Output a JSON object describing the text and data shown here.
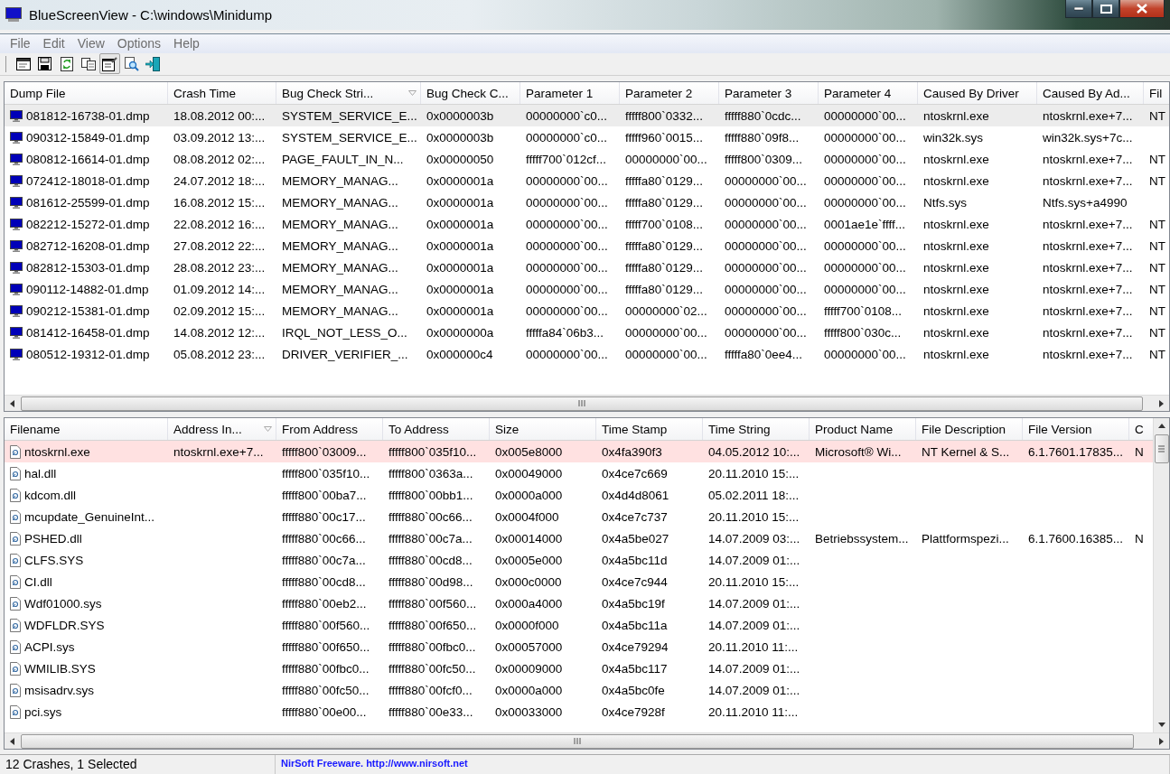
{
  "window": {
    "title": "BlueScreenView  -  C:\\windows\\Minidump"
  },
  "menu": [
    "File",
    "Edit",
    "View",
    "Options",
    "Help"
  ],
  "toolbar": [
    {
      "kind": "window",
      "pressed": false
    },
    {
      "kind": "save",
      "pressed": false
    },
    {
      "kind": "refresh",
      "pressed": false
    },
    {
      "kind": "copy",
      "pressed": false
    },
    {
      "kind": "properties",
      "pressed": true
    },
    {
      "kind": "find",
      "pressed": false
    },
    {
      "kind": "exit",
      "pressed": false
    }
  ],
  "crash_table": {
    "columns": [
      {
        "label": "Dump File",
        "sorted": false
      },
      {
        "label": "Crash Time",
        "sorted": false
      },
      {
        "label": "Bug Check Stri...",
        "sorted": true
      },
      {
        "label": "Bug Check C...",
        "sorted": false
      },
      {
        "label": "Parameter 1",
        "sorted": false
      },
      {
        "label": "Parameter 2",
        "sorted": false
      },
      {
        "label": "Parameter 3",
        "sorted": false
      },
      {
        "label": "Parameter 4",
        "sorted": false
      },
      {
        "label": "Caused By Driver",
        "sorted": false
      },
      {
        "label": "Caused By Ad...",
        "sorted": false
      },
      {
        "label": "Fil",
        "sorted": false
      }
    ],
    "rows": [
      {
        "selected": true,
        "cells": [
          "081812-16738-01.dmp",
          "18.08.2012 00:...",
          "SYSTEM_SERVICE_E...",
          "0x0000003b",
          "00000000`c0...",
          "fffff800`0332...",
          "fffff880`0cdc...",
          "00000000`00...",
          "ntoskrnl.exe",
          "ntoskrnl.exe+7...",
          "NT"
        ]
      },
      {
        "selected": false,
        "cells": [
          "090312-15849-01.dmp",
          "03.09.2012 13:...",
          "SYSTEM_SERVICE_E...",
          "0x0000003b",
          "00000000`c0...",
          "fffff960`0015...",
          "fffff880`09f8...",
          "00000000`00...",
          "win32k.sys",
          "win32k.sys+7c...",
          ""
        ]
      },
      {
        "selected": false,
        "cells": [
          "080812-16614-01.dmp",
          "08.08.2012 02:...",
          "PAGE_FAULT_IN_N...",
          "0x00000050",
          "fffff700`012cf...",
          "00000000`00...",
          "fffff800`0309...",
          "00000000`00...",
          "ntoskrnl.exe",
          "ntoskrnl.exe+7...",
          "NT"
        ]
      },
      {
        "selected": false,
        "cells": [
          "072412-18018-01.dmp",
          "24.07.2012 18:...",
          "MEMORY_MANAG...",
          "0x0000001a",
          "00000000`00...",
          "fffffa80`0129...",
          "00000000`00...",
          "00000000`00...",
          "ntoskrnl.exe",
          "ntoskrnl.exe+7...",
          "NT"
        ]
      },
      {
        "selected": false,
        "cells": [
          "081612-25599-01.dmp",
          "16.08.2012 15:...",
          "MEMORY_MANAG...",
          "0x0000001a",
          "00000000`00...",
          "fffffa80`0129...",
          "00000000`00...",
          "00000000`00...",
          "Ntfs.sys",
          "Ntfs.sys+a4990",
          ""
        ]
      },
      {
        "selected": false,
        "cells": [
          "082212-15272-01.dmp",
          "22.08.2012 16:...",
          "MEMORY_MANAG...",
          "0x0000001a",
          "00000000`00...",
          "fffff700`0108...",
          "00000000`00...",
          "0001ae1e`ffff...",
          "ntoskrnl.exe",
          "ntoskrnl.exe+7...",
          "NT"
        ]
      },
      {
        "selected": false,
        "cells": [
          "082712-16208-01.dmp",
          "27.08.2012 22:...",
          "MEMORY_MANAG...",
          "0x0000001a",
          "00000000`00...",
          "fffffa80`0129...",
          "00000000`00...",
          "00000000`00...",
          "ntoskrnl.exe",
          "ntoskrnl.exe+7...",
          "NT"
        ]
      },
      {
        "selected": false,
        "cells": [
          "082812-15303-01.dmp",
          "28.08.2012 23:...",
          "MEMORY_MANAG...",
          "0x0000001a",
          "00000000`00...",
          "fffffa80`0129...",
          "00000000`00...",
          "00000000`00...",
          "ntoskrnl.exe",
          "ntoskrnl.exe+7...",
          "NT"
        ]
      },
      {
        "selected": false,
        "cells": [
          "090112-14882-01.dmp",
          "01.09.2012 14:...",
          "MEMORY_MANAG...",
          "0x0000001a",
          "00000000`00...",
          "fffffa80`0129...",
          "00000000`00...",
          "00000000`00...",
          "ntoskrnl.exe",
          "ntoskrnl.exe+7...",
          "NT"
        ]
      },
      {
        "selected": false,
        "cells": [
          "090212-15381-01.dmp",
          "02.09.2012 15:...",
          "MEMORY_MANAG...",
          "0x0000001a",
          "00000000`00...",
          "00000000`02...",
          "00000000`00...",
          "fffff700`0108...",
          "ntoskrnl.exe",
          "ntoskrnl.exe+7...",
          "NT"
        ]
      },
      {
        "selected": false,
        "cells": [
          "081412-16458-01.dmp",
          "14.08.2012 12:...",
          "IRQL_NOT_LESS_O...",
          "0x0000000a",
          "fffffa84`06b3...",
          "00000000`00...",
          "00000000`00...",
          "fffff800`030c...",
          "ntoskrnl.exe",
          "ntoskrnl.exe+7...",
          "NT"
        ]
      },
      {
        "selected": false,
        "cells": [
          "080512-19312-01.dmp",
          "05.08.2012 23:...",
          "DRIVER_VERIFIER_...",
          "0x000000c4",
          "00000000`00...",
          "00000000`00...",
          "fffffa80`0ee4...",
          "00000000`00...",
          "ntoskrnl.exe",
          "ntoskrnl.exe+7...",
          "NT"
        ]
      }
    ]
  },
  "driver_table": {
    "columns": [
      {
        "label": "Filename",
        "sorted": false
      },
      {
        "label": "Address In...",
        "sorted": true
      },
      {
        "label": "From Address",
        "sorted": false
      },
      {
        "label": "To Address",
        "sorted": false
      },
      {
        "label": "Size",
        "sorted": false
      },
      {
        "label": "Time Stamp",
        "sorted": false
      },
      {
        "label": "Time String",
        "sorted": false
      },
      {
        "label": "Product Name",
        "sorted": false
      },
      {
        "label": "File Description",
        "sorted": false
      },
      {
        "label": "File Version",
        "sorted": false
      },
      {
        "label": "C",
        "sorted": false
      }
    ],
    "rows": [
      {
        "highlighted": true,
        "cells": [
          "ntoskrnl.exe",
          "ntoskrnl.exe+7...",
          "fffff800`03009...",
          "fffff800`035f10...",
          "0x005e8000",
          "0x4fa390f3",
          "04.05.2012 10:...",
          "Microsoft® Wi...",
          "NT Kernel & S...",
          "6.1.7601.17835...",
          "N"
        ]
      },
      {
        "highlighted": false,
        "cells": [
          "hal.dll",
          "",
          "fffff800`035f10...",
          "fffff800`0363a...",
          "0x00049000",
          "0x4ce7c669",
          "20.11.2010 15:...",
          "",
          "",
          "",
          ""
        ]
      },
      {
        "highlighted": false,
        "cells": [
          "kdcom.dll",
          "",
          "fffff800`00ba7...",
          "fffff800`00bb1...",
          "0x0000a000",
          "0x4d4d8061",
          "05.02.2011 18:...",
          "",
          "",
          "",
          ""
        ]
      },
      {
        "highlighted": false,
        "cells": [
          "mcupdate_GenuineInt...",
          "",
          "fffff880`00c17...",
          "fffff880`00c66...",
          "0x0004f000",
          "0x4ce7c737",
          "20.11.2010 15:...",
          "",
          "",
          "",
          ""
        ]
      },
      {
        "highlighted": false,
        "cells": [
          "PSHED.dll",
          "",
          "fffff880`00c66...",
          "fffff880`00c7a...",
          "0x00014000",
          "0x4a5be027",
          "14.07.2009 03:...",
          "Betriebssystem...",
          "Plattformspezi...",
          "6.1.7600.16385...",
          "N"
        ]
      },
      {
        "highlighted": false,
        "cells": [
          "CLFS.SYS",
          "",
          "fffff880`00c7a...",
          "fffff880`00cd8...",
          "0x0005e000",
          "0x4a5bc11d",
          "14.07.2009 01:...",
          "",
          "",
          "",
          ""
        ]
      },
      {
        "highlighted": false,
        "cells": [
          "CI.dll",
          "",
          "fffff880`00cd8...",
          "fffff880`00d98...",
          "0x000c0000",
          "0x4ce7c944",
          "20.11.2010 15:...",
          "",
          "",
          "",
          ""
        ]
      },
      {
        "highlighted": false,
        "cells": [
          "Wdf01000.sys",
          "",
          "fffff880`00eb2...",
          "fffff880`00f560...",
          "0x000a4000",
          "0x4a5bc19f",
          "14.07.2009 01:...",
          "",
          "",
          "",
          ""
        ]
      },
      {
        "highlighted": false,
        "cells": [
          "WDFLDR.SYS",
          "",
          "fffff880`00f560...",
          "fffff880`00f650...",
          "0x0000f000",
          "0x4a5bc11a",
          "14.07.2009 01:...",
          "",
          "",
          "",
          ""
        ]
      },
      {
        "highlighted": false,
        "cells": [
          "ACPI.sys",
          "",
          "fffff880`00f650...",
          "fffff880`00fbc0...",
          "0x00057000",
          "0x4ce79294",
          "20.11.2010 11:...",
          "",
          "",
          "",
          ""
        ]
      },
      {
        "highlighted": false,
        "cells": [
          "WMILIB.SYS",
          "",
          "fffff880`00fbc0...",
          "fffff880`00fc50...",
          "0x00009000",
          "0x4a5bc117",
          "14.07.2009 01:...",
          "",
          "",
          "",
          ""
        ]
      },
      {
        "highlighted": false,
        "cells": [
          "msisadrv.sys",
          "",
          "fffff880`00fc50...",
          "fffff880`00fcf0...",
          "0x0000a000",
          "0x4a5bc0fe",
          "14.07.2009 01:...",
          "",
          "",
          "",
          ""
        ]
      },
      {
        "highlighted": false,
        "cells": [
          "pci.sys",
          "",
          "fffff880`00e00...",
          "fffff880`00e33...",
          "0x00033000",
          "0x4ce7928f",
          "20.11.2010 11:...",
          "",
          "",
          "",
          ""
        ]
      }
    ]
  },
  "status_bar": {
    "summary": "12 Crashes, 1 Selected",
    "link": "NirSoft Freeware.  http://www.nirsoft.net"
  }
}
